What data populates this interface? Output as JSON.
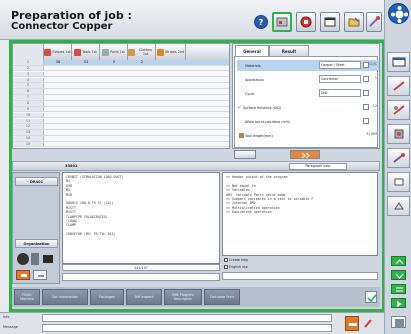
{
  "header": {
    "title_line1": "Preparation of job :",
    "title_line2": "Connector Copper"
  },
  "table": {
    "columns": [
      "Stripes 1st",
      "Tools 1st",
      "Parts 1st",
      "Clothes 1st",
      "Stripes 2nd"
    ],
    "selected_values": [
      "58",
      "53",
      "5",
      "2"
    ],
    "row_numbers": [
      "1",
      "2",
      "3",
      "4",
      "5",
      "6",
      "7",
      "8",
      "9",
      "10",
      "11",
      "12",
      "13",
      "14",
      "15"
    ]
  },
  "params": {
    "tab_general": "General",
    "tab_result": "Result",
    "rows": [
      {
        "label": "Materials",
        "value": "Copper / Steel",
        "unit": "CU/C"
      },
      {
        "label": "Application",
        "value": "Connector",
        "unit": "1"
      },
      {
        "label": "Cycle",
        "value": "Dist.",
        "unit": ""
      },
      {
        "label": "Surface finishing (UID)",
        "value": "",
        "unit": "12"
      },
      {
        "label": "Allow burst-corridors (m%)",
        "value": "",
        "unit": ""
      },
      {
        "label": "Tool length(mm)",
        "value": "",
        "unit": "31 MM"
      }
    ]
  },
  "midbar": {
    "left_label": "33801",
    "button": "Paragraph help"
  },
  "leftpane": {
    "top_tab": "DR401",
    "bottom_tab": "Organization"
  },
  "code_lines": [
    "CRVNIT (SIMULATION LOAD DUCT)",
    "N3",
    "G90",
    "M3",
    "M10",
    "",
    "G0G0(X 100.0 Y5 T1 (1X))",
    "M1STT",
    "M1STT",
    "CLAMPCPR FOLAECROCEX)",
    "(LOAD)",
    "CLAMP",
    "",
    "CONVEYOR (MV: P5 TW: 811)"
  ],
  "comment_lines": [
    ">> Header output of the program",
    "",
    ">> Not equal to",
    ">> Variables",
    "#M1  Variable Parts value mode",
    ">> Subpart variables in a test to variable F",
    ">> Internal #M2",
    ">> Multiplication operation",
    ">> Equivalent operation"
  ],
  "code_status": "141/147",
  "checkboxes": {
    "create_help": "Create help",
    "english_use": "English use"
  },
  "bottom_tabs": [
    "Finish Machine",
    "Set Information",
    "Packages",
    "Diff Inspect",
    "Edit Program Description",
    "Calculate Price"
  ],
  "status": {
    "row1_label": "Info",
    "row2_label": "Message"
  },
  "colors": {
    "accent_green": "#2fb24a",
    "selection_blue": "#b9d3ef",
    "tab_gray": "#6d7a8c"
  }
}
